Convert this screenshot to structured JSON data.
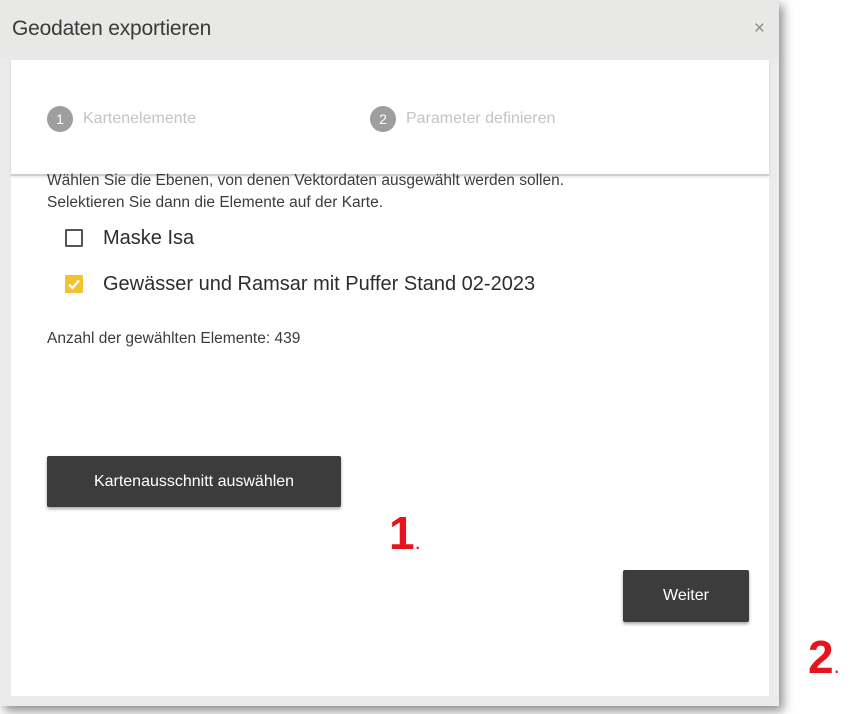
{
  "dialog": {
    "title": "Geodaten exportieren",
    "close_symbol": "×"
  },
  "stepper": {
    "steps": [
      {
        "number": "1",
        "label": "Kartenelemente"
      },
      {
        "number": "2",
        "label": "Parameter definieren"
      }
    ]
  },
  "content": {
    "intro_line1": "Wählen Sie die Ebenen, von denen Vektordaten ausgewählt werden sollen.",
    "intro_line2": "Selektieren Sie dann die Elemente auf der Karte.",
    "layers": [
      {
        "label": "Maske Isa",
        "checked": false
      },
      {
        "label": "Gewässer und Ramsar mit Puffer Stand 02-2023",
        "checked": true
      }
    ],
    "count_text": "Anzahl der gewählten Elemente: 439"
  },
  "buttons": {
    "select_extent_label": "Kartenausschnitt auswählen",
    "next_label": "Weiter"
  },
  "annotations": {
    "marker1_number": "1",
    "marker1_dot": ".",
    "marker2_number": "2",
    "marker2_dot": "."
  },
  "colors": {
    "accent_checkbox": "#f2c230",
    "button_bg": "#3c3c3c",
    "annotation_red": "#e8131b"
  },
  "icons": {
    "close": "close-icon",
    "checkbox_checked": "checkmark-icon"
  }
}
